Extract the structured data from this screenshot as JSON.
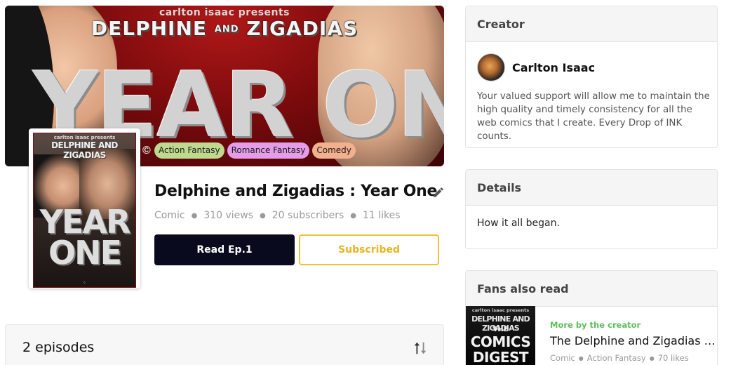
{
  "banner": {
    "presents": "carlton isaac presents",
    "series_left": "DELPHINE",
    "series_and": "AND",
    "series_right": "ZIGADIAS",
    "big_title": "YEAR ONE",
    "tags": [
      "Action Fantasy",
      "Romance Fantasy",
      "Comedy"
    ],
    "tag_colors": [
      "#bfd98e",
      "#e59ce9",
      "#f2b08e"
    ]
  },
  "cover": {
    "presents": "carlton isaac presents",
    "series": "DELPHINE AND ZIGADIAS",
    "title_line1": "YEAR",
    "title_line2": "ONE"
  },
  "comic": {
    "title": "Delphine and Zigadias : Year One",
    "edit_icon": "pencil-icon",
    "meta": [
      "Comic",
      "310 views",
      "20 subscribers",
      "11 likes"
    ],
    "read_label": "Read Ep.1",
    "subscribed_label": "Subscribed"
  },
  "episodes": {
    "count_label": "2 episodes",
    "sort_icon": "sort-icon"
  },
  "sidebar": {
    "creator": {
      "heading": "Creator",
      "name": "Carlton Isaac",
      "bio": "Your valued support will allow me to maintain the high quality and timely consistency for all the web comics that I create. Every Drop of INK counts."
    },
    "details": {
      "heading": "Details",
      "text": "How it all began."
    },
    "fans": {
      "heading": "Fans also read",
      "item": {
        "thumb_presents": "carlton isaac presents",
        "thumb_series": "DELPHINE AND ZIGADIAS",
        "thumb_the": "THE",
        "thumb_big": "COMICS DIGEST",
        "label": "More by the creator",
        "title": "The Delphine and Zigadias Comics Digest",
        "meta": [
          "Comic",
          "Action Fantasy",
          "70 likes"
        ]
      }
    }
  },
  "colors": {
    "primary_button": "#0a0a1f",
    "subscribe_accent": "#f0c23a",
    "more_by_creator": "#5cbf5c"
  }
}
